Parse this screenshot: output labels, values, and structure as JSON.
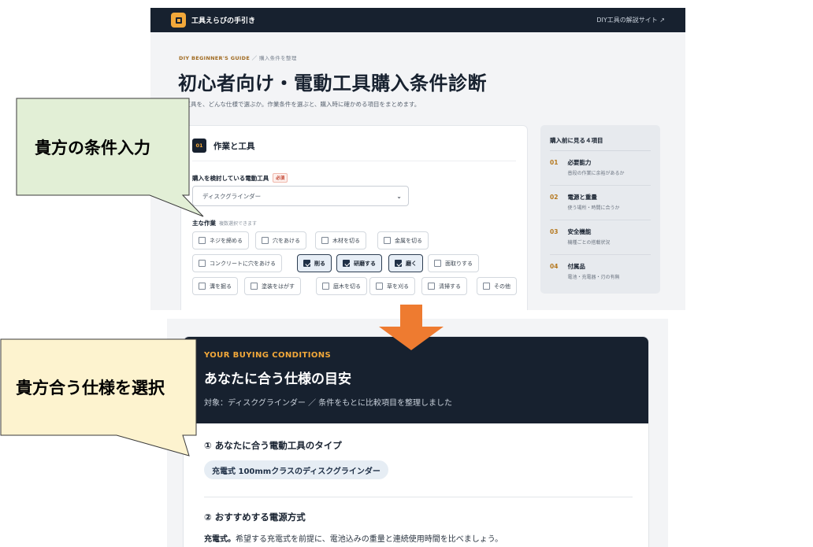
{
  "top_screen": {
    "nav": {
      "brand": "工具えらびの手引き",
      "link": "DIY工具の解説サイト ↗"
    },
    "breadcrumb": {
      "guide": "DIY BEGINNER'S GUIDE",
      "sep": "／",
      "current": "購入条件を整理"
    },
    "title": "初心者向け・電動工具購入条件診断",
    "description": "の工具を、どんな仕様で選ぶか。作業条件を選ぶと、購入時に確かめる項目をまとめます。",
    "step": {
      "number": "01",
      "title": "作業と工具",
      "tool_label": "購入を検討している電動工具",
      "required": "必須",
      "tool_value": "ディスクグラインダー",
      "work_label": "主な作業",
      "work_note": "複数選択できます",
      "options": [
        {
          "label": "ネジを締める",
          "checked": false
        },
        {
          "label": "穴をあける",
          "checked": false
        },
        {
          "label": "木材を切る",
          "checked": false
        },
        {
          "label": "金属を切る",
          "checked": false
        },
        {
          "label": "コンクリートに穴をあける",
          "checked": false
        },
        {
          "label": "削る",
          "checked": true
        },
        {
          "label": "研磨する",
          "checked": true
        },
        {
          "label": "磨く",
          "checked": true
        },
        {
          "label": "面取りする",
          "checked": false
        },
        {
          "label": "溝を掘る",
          "checked": false
        },
        {
          "label": "塗装をはがす",
          "checked": false
        },
        {
          "label": "庭木を切る",
          "checked": false
        },
        {
          "label": "草を刈る",
          "checked": false
        },
        {
          "label": "清掃する",
          "checked": false
        },
        {
          "label": "その他",
          "checked": false
        }
      ]
    },
    "sidebar": {
      "title": "購入前に見る４項目",
      "items": [
        {
          "no": "01",
          "name": "必要能力",
          "desc": "普段の作業に余裕があるか"
        },
        {
          "no": "02",
          "name": "電源と重量",
          "desc": "使う場所・時間に合うか"
        },
        {
          "no": "03",
          "name": "安全機能",
          "desc": "機種ごとの搭載状況"
        },
        {
          "no": "04",
          "name": "付属品",
          "desc": "電池・充電器・刃の有無"
        }
      ]
    }
  },
  "bottom_screen": {
    "eyebrow": "YOUR BUYING CONDITIONS",
    "title": "あなたに合う仕様の目安",
    "subtitle": "対象：ディスクグラインダー ／ 条件をもとに比較項目を整理しました",
    "section1": "① あなたに合う電動工具のタイプ",
    "pill": "充電式 100mmクラスのディスクグラインダー",
    "section2": "② おすすめする電源方式",
    "text_bold": "充電式。",
    "text_rest": "希望する充電式を前提に、電池込みの重量と連続使用時間を比べましょう。"
  },
  "callouts": {
    "input": "貴方の条件入力",
    "select": "貴方合う仕様を選択"
  },
  "colors": {
    "navy": "#17212f",
    "accent": "#f2a83a",
    "arrow": "#ee7b30",
    "callout_green": "#e2efd6",
    "callout_yellow": "#fdf3cf"
  },
  "icons": {
    "logo": "square-logo-icon",
    "select": "chevron-down-icon",
    "arrow": "arrow-down-icon",
    "checkbox": "checkbox-icon"
  }
}
